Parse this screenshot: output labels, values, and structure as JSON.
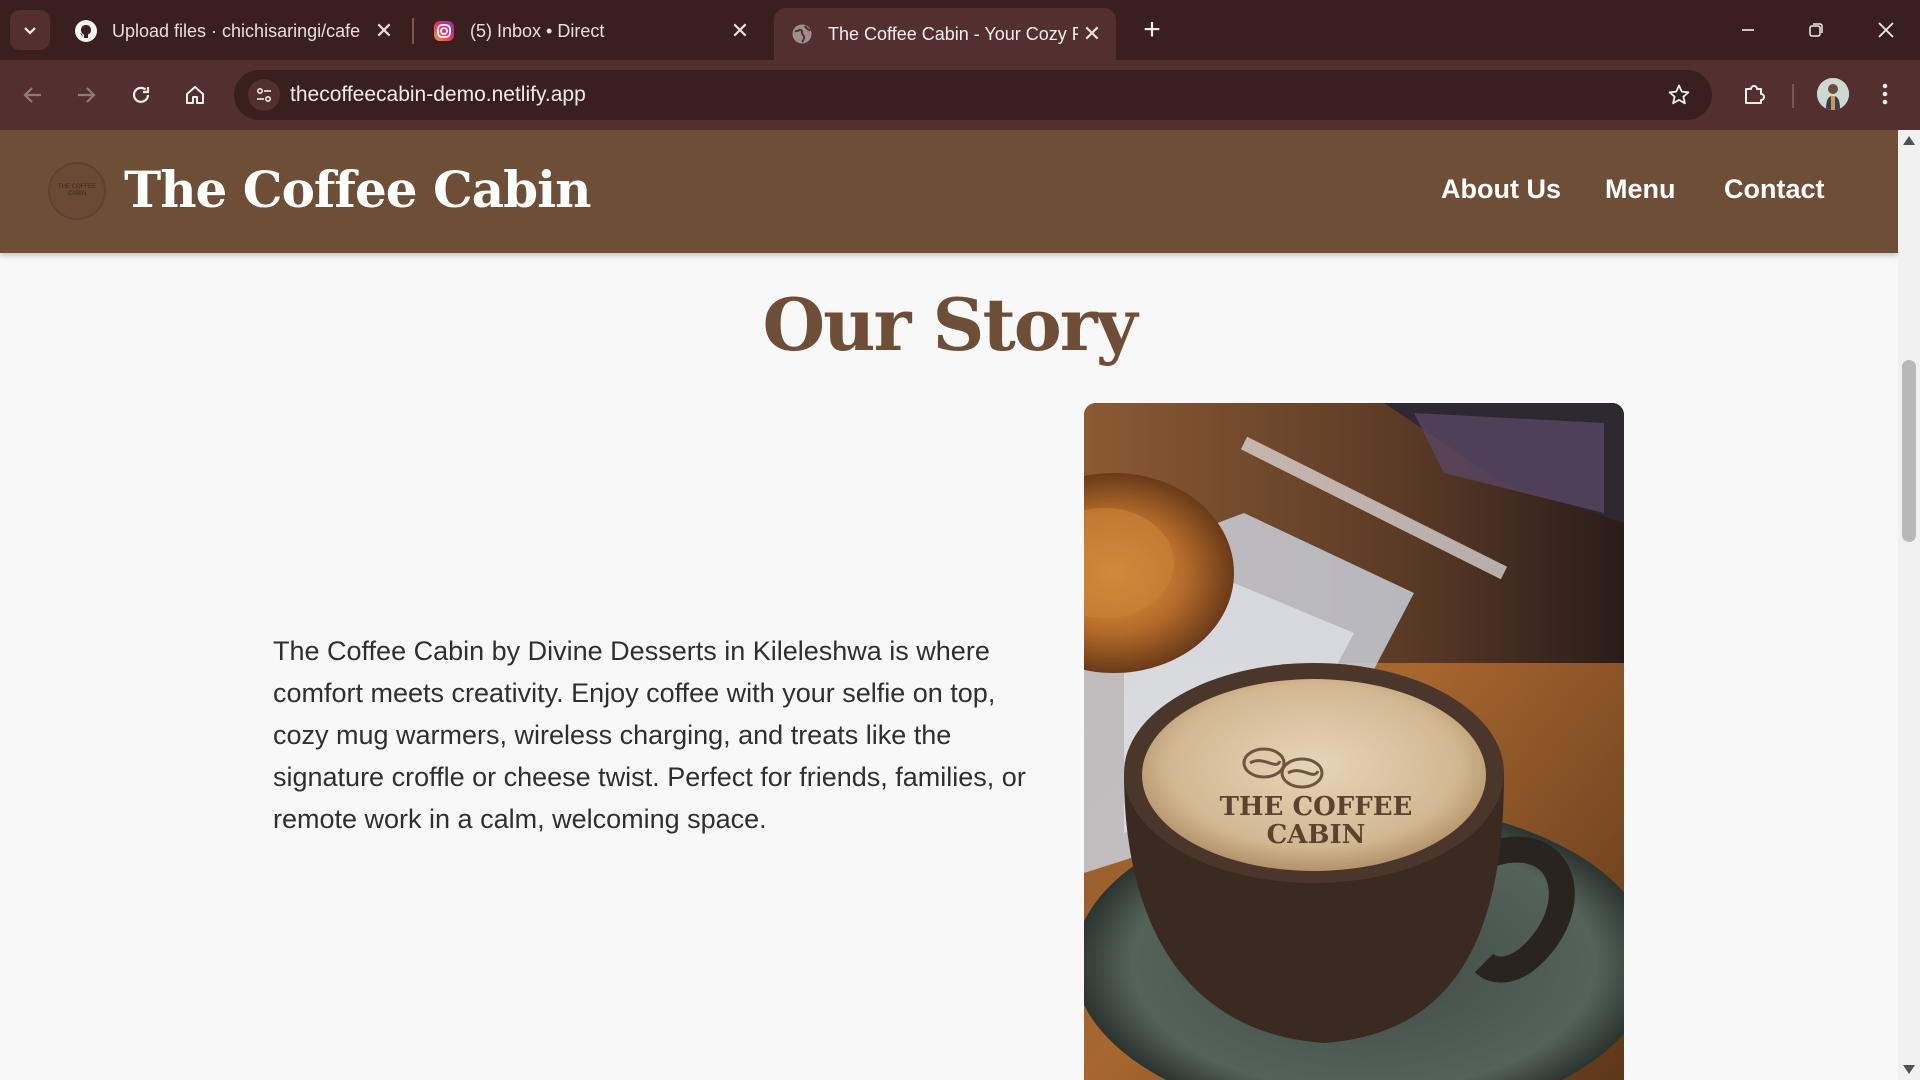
{
  "browser": {
    "tabs": [
      {
        "title": "Upload files · chichisaringi/cafe",
        "icon": "github-icon",
        "active": false
      },
      {
        "title": "(5) Inbox • Direct",
        "icon": "instagram-icon",
        "active": false
      },
      {
        "title": "The Coffee Cabin - Your Cozy R",
        "icon": "globe-icon",
        "active": true
      }
    ],
    "url": "thecoffeecabin-demo.netlify.app"
  },
  "site": {
    "title": "The Coffee Cabin",
    "logo_text": "THE COFFEE CABIN",
    "nav": [
      "About Us",
      "Menu",
      "Contact"
    ]
  },
  "story": {
    "heading": "Our Story",
    "paragraph": "The Coffee Cabin by Divine Desserts in Kileleshwa is where comfort meets creativity. Enjoy coffee with your selfie on top, cozy mug warmers, wireless charging, and treats like the signature croffle or cheese twist. Perfect for friends, families, or remote work in a calm, welcoming space.",
    "image_cup_text_line1": "THE COFFEE",
    "image_cup_text_line2": "CABIN"
  },
  "colors": {
    "header_brown": "#6f4e37",
    "chrome_dark": "#3a1f1f",
    "chrome_toolbar": "#542f2f"
  }
}
